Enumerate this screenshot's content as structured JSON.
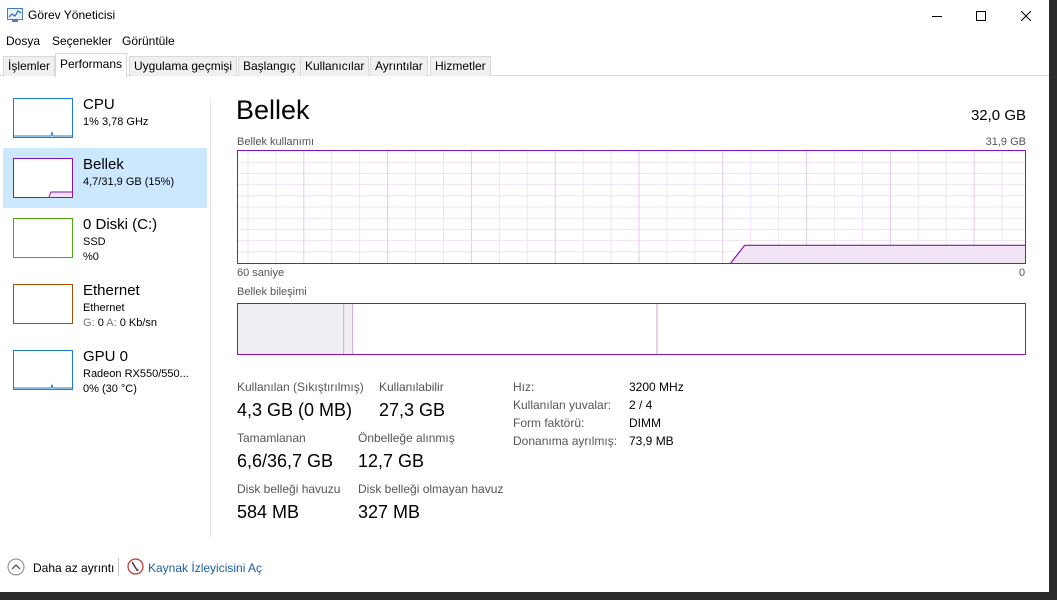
{
  "window": {
    "title": "Görev Yöneticisi"
  },
  "menu": [
    "Dosya",
    "Seçenekler",
    "Görüntüle"
  ],
  "tabs": [
    {
      "label": "İşlemler",
      "active": false
    },
    {
      "label": "Performans",
      "active": true
    },
    {
      "label": "Uygulama geçmişi",
      "active": false
    },
    {
      "label": "Başlangıç",
      "active": false
    },
    {
      "label": "Kullanıcılar",
      "active": false
    },
    {
      "label": "Ayrıntılar",
      "active": false
    },
    {
      "label": "Hizmetler",
      "active": false
    }
  ],
  "sidebar": {
    "items": [
      {
        "name": "CPU",
        "line1": "1% 3,78 GHz",
        "line2": "",
        "color": "#1c7fc2",
        "active": false
      },
      {
        "name": "Bellek",
        "line1": "4,7/31,9 GB (15%)",
        "line2": "",
        "color": "#8b12ae",
        "active": true
      },
      {
        "name": "0 Diski (C:)",
        "line1": "SSD",
        "line2": "%0",
        "color": "#4da60c",
        "active": false
      },
      {
        "name": "Ethernet",
        "line1": "Ethernet",
        "line2_label_g": "G:",
        "line2_value_g": "0",
        "line2_label_a": "A:",
        "line2_value_a": "0 Kb/sn",
        "color": "#a74f01",
        "active": false
      },
      {
        "name": "GPU 0",
        "line1": "Radeon RX550/550...",
        "line2": "0% (30 °C)",
        "color": "#1c7fc2",
        "active": false
      }
    ]
  },
  "main": {
    "title": "Bellek",
    "total": "32,0 GB",
    "usage_label": "Bellek kullanımı",
    "usage_max": "31,9 GB",
    "time_left": "60 saniye",
    "time_right": "0",
    "composition_label": "Bellek bileşimi"
  },
  "stats": {
    "used_label": "Kullanılan (Sıkıştırılmış)",
    "used_value": "4,3 GB (0 MB)",
    "available_label": "Kullanılabilir",
    "available_value": "27,3 GB",
    "committed_label": "Tamamlanan",
    "committed_value": "6,6/36,7 GB",
    "cached_label": "Önbelleğe alınmış",
    "cached_value": "12,7 GB",
    "paged_label": "Disk belleği havuzu",
    "paged_value": "584 MB",
    "nonpaged_label": "Disk belleği olmayan havuz",
    "nonpaged_value": "327 MB"
  },
  "info": [
    {
      "label": "Hız:",
      "value": "3200 MHz"
    },
    {
      "label": "Kullanılan yuvalar:",
      "value": "2 / 4"
    },
    {
      "label": "Form faktörü:",
      "value": "DIMM"
    },
    {
      "label": "Donanıma ayrılmış:",
      "value": "73,9 MB"
    }
  ],
  "footer": {
    "less_details": "Daha az ayrıntı",
    "resource_monitor": "Kaynak İzleyicisini Aç"
  },
  "colors": {
    "memory": "#8b12ae",
    "selected": "#cce8ff"
  }
}
